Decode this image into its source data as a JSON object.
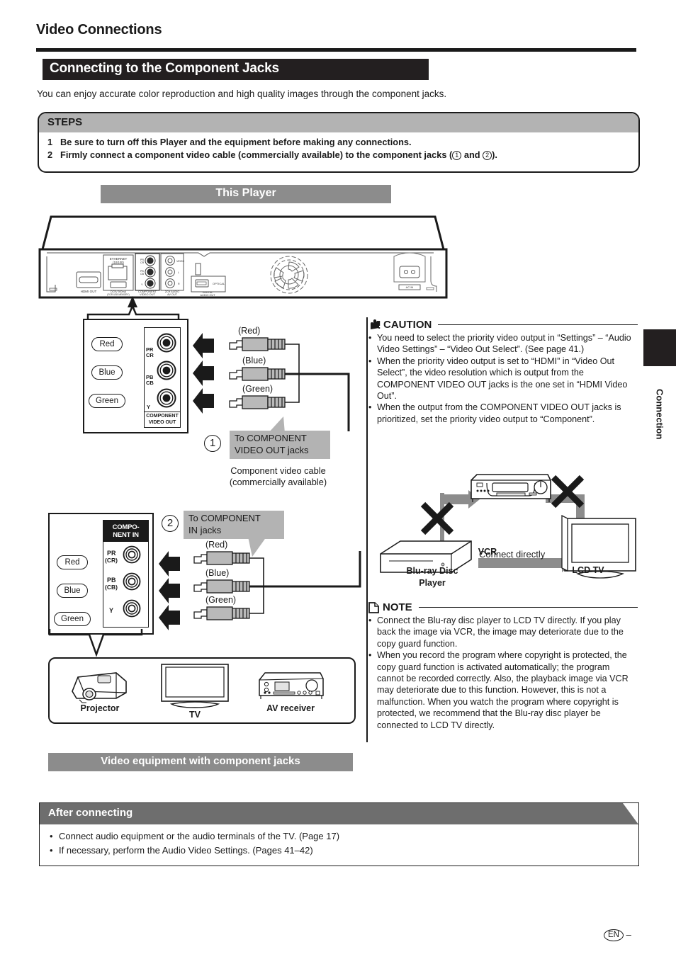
{
  "header": {
    "running_title": "Video Connections",
    "section_title": "Connecting to the Component Jacks",
    "intro": "You can enjoy accurate color reproduction and high quality images through the component jacks."
  },
  "steps": {
    "heading": "STEPS",
    "items": [
      {
        "num": "1",
        "text": "Be sure to turn off this Player and the equipment before making any connections."
      },
      {
        "num": "2",
        "text_a": "Firmly connect a component video cable (commercially available) to the component jacks (",
        "circ_a": "1",
        "text_b": " and ",
        "circ_b": "2",
        "text_c": ")."
      }
    ]
  },
  "player_banner": "This Player",
  "rear_panel": {
    "labels": {
      "hdmi_out": "HDMI OUT",
      "ethernet": "ETHERNET",
      "ethernet_sub": "(10/100)",
      "usb": "DC5V 500mA",
      "usb_sub": "(FOR USB MEMORY)",
      "component": "COMPONENT",
      "component_sub": "VIDEO OUT",
      "av_out": "2CH AUDIO",
      "av_out_sub": "AV OUT",
      "optical": "OPTICAL",
      "digital": "DIGITAL",
      "digital_sub": "AUDIO OUT",
      "ac_in": "AC IN",
      "pr": "PR",
      "cr": "CR",
      "pb": "PB",
      "cb": "CB",
      "y": "Y",
      "video": "VIDEO",
      "ch_l": "L",
      "ch_r": "R"
    }
  },
  "out_panel": {
    "colors": [
      "Red",
      "Blue",
      "Green"
    ],
    "jack_labels": [
      {
        "main": "PR",
        "sub": "CR"
      },
      {
        "main": "PB",
        "sub": "CB"
      },
      {
        "main": "Y",
        "sub": ""
      }
    ],
    "footer_line1": "COMPONENT",
    "footer_line2": "VIDEO OUT"
  },
  "in_panel": {
    "colors": [
      "Red",
      "Blue",
      "Green"
    ],
    "heading_line1": "COMPO-",
    "heading_line2": "NENT IN",
    "jack_labels": [
      {
        "main": "PR",
        "sub": "(CR)"
      },
      {
        "main": "PB",
        "sub": "(CB)"
      },
      {
        "main": "Y",
        "sub": ""
      }
    ]
  },
  "cable_top": {
    "plug_labels": [
      "(Red)",
      "(Blue)",
      "(Green)"
    ],
    "step_num": "1",
    "callout_line1": "To COMPONENT",
    "callout_line2": "VIDEO OUT jacks",
    "caption_line1": "Component video cable",
    "caption_line2": "(commercially available)"
  },
  "cable_bottom": {
    "plug_labels": [
      "(Red)",
      "(Blue)",
      "(Green)"
    ],
    "step_num": "2",
    "callout_line1": "To COMPONENT",
    "callout_line2": "IN jacks"
  },
  "equipment": {
    "items": [
      {
        "label": "Projector",
        "icon": "projector-icon"
      },
      {
        "label": "TV",
        "icon": "tv-icon"
      },
      {
        "label": "AV receiver",
        "icon": "av-receiver-icon"
      }
    ],
    "banner": "Video equipment with component jacks"
  },
  "caution": {
    "heading": "CAUTION",
    "bullets": [
      "You need to select the priority video output in “Settings” – “Audio Video Settings” – “Video Out Select”. (See page 41.)",
      "When the priority video output is set to “HDMI” in “Video Out Select”, the video resolution which is output from the COMPONENT VIDEO OUT jacks is the one set in “HDMI Video Out”.",
      "When the output from the COMPONENT VIDEO OUT jacks is prioritized, set the priority video output to “Component”."
    ]
  },
  "vcr_figure": {
    "vcr_label": "VCR",
    "player_label_line1": "Blu-ray Disc",
    "player_label_line2": "Player",
    "tv_label": "LCD TV",
    "connect_text": "Connect directly"
  },
  "note": {
    "heading": "NOTE",
    "bullets": [
      "Connect the Blu-ray disc player to LCD TV directly. If you play back the image via VCR, the image may deteriorate due to the copy guard function.",
      "When you record the program where copyright is protected, the copy guard function is activated automatically; the program cannot be recorded correctly. Also, the playback image via VCR may deteriorate due to this function. However, this is not a malfunction. When you watch the program where copyright is protected, we recommend that the Blu-ray disc player be connected to LCD TV directly."
    ]
  },
  "after_connecting": {
    "heading": "After connecting",
    "bullets": [
      "Connect audio equipment or the audio terminals of the TV. (Page 17)",
      "If necessary, perform the Audio Video Settings. (Pages 41–42)"
    ]
  },
  "side_tab": "Connection",
  "footer": {
    "lang": "EN",
    "dash": "–"
  },
  "colors": {
    "ink": "#1a1a1a",
    "banner_gray": "#8c8c8c",
    "steps_gray": "#b3b3b3",
    "after_gray": "#6e6e6e",
    "plug_gray": "#b9b9b9"
  }
}
